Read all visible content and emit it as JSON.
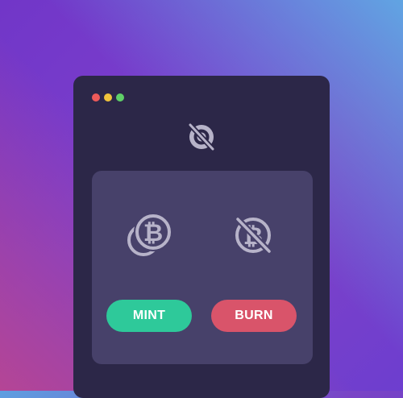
{
  "colors": {
    "window_bg": "#2c2748",
    "card_bg": "#47416a",
    "icon": "#b7b3c9",
    "mint": "#2ec99a",
    "burn": "#d9546a"
  },
  "window": {
    "controls": [
      "close",
      "minimize",
      "maximize"
    ],
    "logo_icon": "no-symbol-coin-logo-icon"
  },
  "actions": {
    "mint": {
      "icon": "bitcoin-coins-icon",
      "label": "MINT"
    },
    "burn": {
      "icon": "bitcoin-crossed-icon",
      "label": "BURN"
    }
  }
}
